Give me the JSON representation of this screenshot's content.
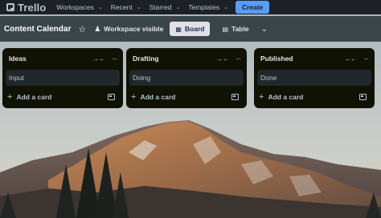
{
  "topnav": {
    "logo_text": "Trello",
    "items": [
      {
        "label": "Workspaces"
      },
      {
        "label": "Recent"
      },
      {
        "label": "Starred"
      },
      {
        "label": "Templates"
      }
    ],
    "create_label": "Create"
  },
  "board": {
    "title": "Content Calendar",
    "visibility_label": "Workspace visible",
    "views": [
      {
        "label": "Board",
        "active": true
      },
      {
        "label": "Table",
        "active": false
      }
    ]
  },
  "lists": [
    {
      "title": "Ideas",
      "cards": [
        "Input"
      ],
      "add_label": "Add a card"
    },
    {
      "title": "Drafting",
      "cards": [
        "Doing"
      ],
      "add_label": "Add a card"
    },
    {
      "title": "Published",
      "cards": [
        "Done"
      ],
      "add_label": "Add a card"
    }
  ],
  "colors": {
    "nav_bg": "#1d2125",
    "accent": "#579dff",
    "list_bg": "#101204",
    "card_bg": "#22272b"
  },
  "icons": [
    "trello-logo-icon",
    "chevron-down-icon",
    "star-icon",
    "people-icon",
    "board-view-icon",
    "table-view-icon",
    "collapse-icon",
    "more-icon",
    "plus-icon",
    "template-icon"
  ]
}
